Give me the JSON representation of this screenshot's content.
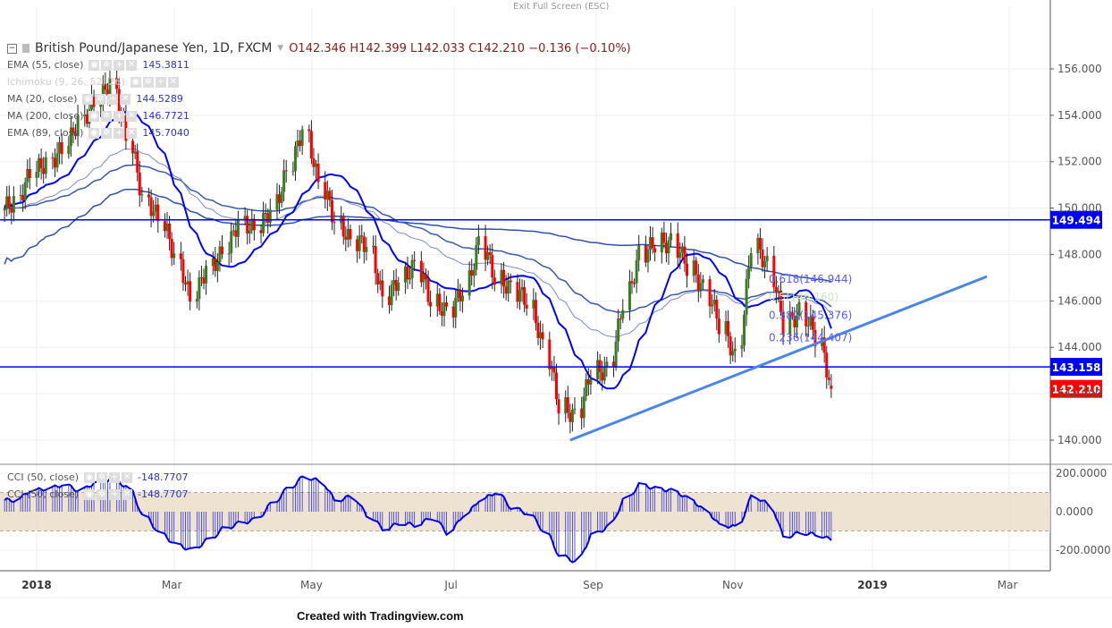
{
  "header": {
    "exit_fullscreen": "Exit Full Screen (ESC)",
    "symbol": "British Pound/Japanese Yen, 1D, FXCM",
    "open": "O142.346",
    "high": "H142.399",
    "low": "L142.033",
    "close": "C142.210",
    "change": "−0.136 (−0.10%)"
  },
  "indicators": [
    {
      "label": "EMA (55, close)",
      "value": "145.3811"
    },
    {
      "label": "Ichimoku (9, 26, 52, 26)",
      "value": ""
    },
    {
      "label": "MA (20, close)",
      "value": "144.5289"
    },
    {
      "label": "MA (200, close)",
      "value": "146.7721"
    },
    {
      "label": "EMA (89, close)",
      "value": "145.7040"
    }
  ],
  "cci_legend": [
    {
      "label": "CCI (50, close)",
      "value": "-148.7707"
    },
    {
      "label": "CCI (50, close)",
      "value": "-148.7707"
    }
  ],
  "footer": {
    "credit": "Created with Tradingview.com"
  },
  "colors": {
    "up": "#3a7d1e",
    "down": "#ff0000",
    "ma": "#0000ff",
    "level": "#0000ff",
    "trend": "#4a86e8",
    "cci_band": "#e8dcc4"
  },
  "chart_data": {
    "type": "candlestick",
    "title": "British Pound/Japanese Yen, 1D, FXCM",
    "ylim": [
      139.5,
      157.5
    ],
    "yticks": [
      "156.000",
      "154.000",
      "152.000",
      "150.000",
      "148.000",
      "146.000",
      "144.000",
      "142.000",
      "140.000"
    ],
    "xticks": [
      {
        "label": "2018",
        "date": "2018-01-01",
        "bold": true
      },
      {
        "label": "Mar",
        "date": "2018-03-01"
      },
      {
        "label": "May",
        "date": "2018-05-01"
      },
      {
        "label": "Jul",
        "date": "2018-07-01"
      },
      {
        "label": "Sep",
        "date": "2018-09-01"
      },
      {
        "label": "Nov",
        "date": "2018-11-01"
      },
      {
        "label": "2019",
        "date": "2019-01-01",
        "bold": true
      },
      {
        "label": "Mar",
        "date": "2019-03-01"
      }
    ],
    "weekly_start": "2017-12-18",
    "weekly_close": [
      150.3,
      151.5,
      152,
      152.5,
      153.8,
      154.5,
      155.5,
      153,
      150.5,
      149.5,
      148,
      146,
      147.5,
      148,
      149.5,
      149,
      150,
      151.5,
      153.5,
      151,
      149.5,
      148.5,
      148.5,
      146,
      147,
      147.5,
      146,
      145.5,
      146.5,
      148.5,
      147,
      146.5,
      146,
      144,
      141.5,
      141,
      143,
      143,
      146,
      148,
      148.5,
      148.5,
      147.5,
      146.5,
      145,
      143.5,
      148.5,
      147.5,
      145,
      145.5,
      144.5,
      142.21
    ],
    "horizontal_levels": [
      {
        "value": 149.494,
        "label": "149.494"
      },
      {
        "value": 143.158,
        "label": "143.158"
      }
    ],
    "last_price": {
      "value": 142.21,
      "label": "142.210"
    },
    "trendline": {
      "from": {
        "date": "2018-08-22",
        "price": 140.0
      },
      "to": {
        "date": "2019-02-20",
        "price": 147.05
      }
    },
    "fib_levels": [
      {
        "label": "0.618(146.944)",
        "value": 146.944
      },
      {
        "label": "0.5(146.160)",
        "value": 146.16
      },
      {
        "label": "0.382(145.376)",
        "value": 145.376
      },
      {
        "label": "0.236(144.407)",
        "value": 144.407
      }
    ],
    "cci": {
      "ylim": [
        -300,
        250
      ],
      "yticks": [
        "200.0000",
        "0.0000",
        "-200.0000"
      ],
      "band": [
        -100,
        100
      ],
      "weekly": [
        60,
        110,
        120,
        140,
        110,
        150,
        170,
        130,
        -20,
        -110,
        -170,
        -200,
        -150,
        -90,
        -60,
        -40,
        40,
        120,
        180,
        160,
        60,
        80,
        -20,
        -90,
        -60,
        -70,
        -30,
        -110,
        -20,
        60,
        100,
        20,
        -10,
        -100,
        -230,
        -260,
        -120,
        -80,
        60,
        140,
        120,
        110,
        70,
        10,
        -70,
        -80,
        80,
        40,
        -130,
        -110,
        -120,
        -148.77
      ]
    }
  }
}
